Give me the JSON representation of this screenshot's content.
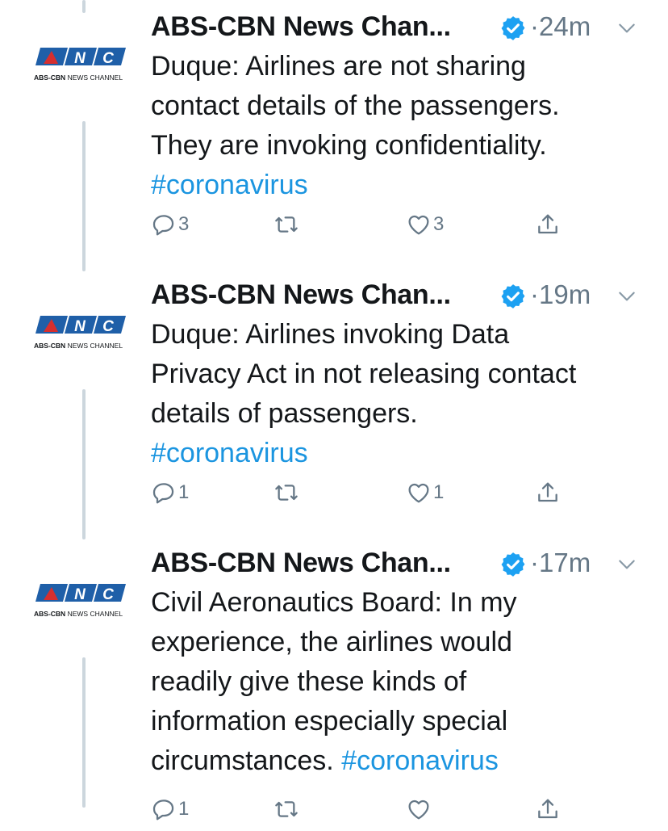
{
  "colors": {
    "text": "#14171a",
    "muted": "#657786",
    "link": "#1b95e0",
    "verified": "#1da1f2",
    "thread": "#ccd6dd",
    "brand_blue": "#1f5fa8",
    "brand_red": "#d62f2f"
  },
  "avatar": {
    "logo_text": "ANC",
    "caption_bold": "ABS-CBN",
    "caption_rest": "NEWS CHANNEL"
  },
  "tweets": [
    {
      "account_name": "ABS-CBN News Chan...",
      "time": "24m",
      "text_lines": [
        "Duque: Airlines are not sharing",
        "contact details of the passengers.",
        "They are invoking confidentiality."
      ],
      "tail_text": "",
      "hashtag": "#coronavirus",
      "replies": "3",
      "retweets": "",
      "likes": "3"
    },
    {
      "account_name": "ABS-CBN News Chan...",
      "time": "19m",
      "text_lines": [
        "Duque: Airlines invoking Data",
        "Privacy Act in not releasing contact",
        "details of passengers."
      ],
      "tail_text": "",
      "hashtag": "#coronavirus",
      "replies": "1",
      "retweets": "",
      "likes": "1"
    },
    {
      "account_name": "ABS-CBN News Chan...",
      "time": "17m",
      "text_lines": [
        "Civil Aeronautics Board: In my",
        "experience, the airlines would",
        "readily give these kinds of",
        "information especially special"
      ],
      "tail_text": "circumstances. ",
      "hashtag": "#coronavirus",
      "replies": "1",
      "retweets": "",
      "likes": ""
    }
  ]
}
